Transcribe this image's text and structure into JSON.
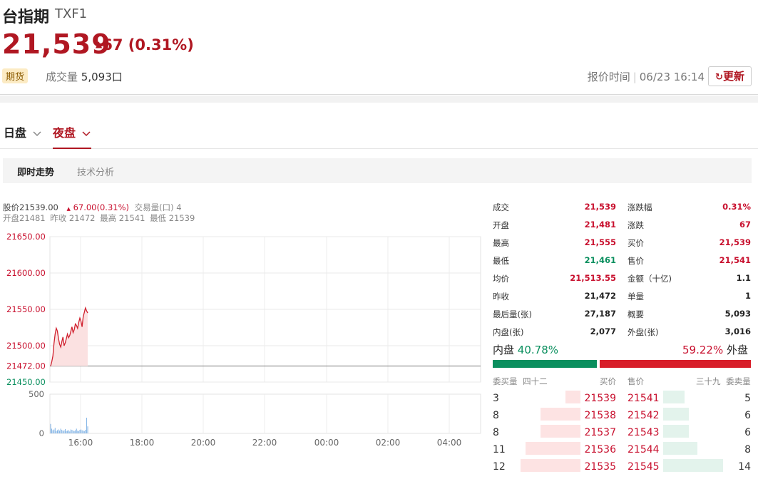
{
  "header": {
    "title": "台指期",
    "symbol": "TXF1",
    "price": "21,539",
    "change_arrow": "▲",
    "change": "67 (0.31%)",
    "badge": "期货",
    "volume_label": "成交量",
    "volume_value": "5,093口",
    "quote_time_label": "报价时间",
    "quote_time": "06/23 16:14",
    "refresh_label": "更新"
  },
  "session_tabs": {
    "day": "日盘",
    "night": "夜盘"
  },
  "sub_tabs": {
    "realtime": "即时走势",
    "technical": "技术分析"
  },
  "chart_info": {
    "line1": {
      "price": "股价21539.00",
      "change_arrow": "▲",
      "change": "67.00(0.31%)",
      "vol": "交易量(口) 4"
    },
    "line2": {
      "open": "开盘21481",
      "prev": "昨收 21472",
      "high": "最高 21541",
      "low": "最低 21539"
    }
  },
  "chart_data": {
    "type": "line",
    "price_axis": [
      "21650.00",
      "21600.00",
      "21550.00",
      "21500.00",
      "21472.00",
      "21450.00"
    ],
    "volume_axis": [
      "500",
      "0"
    ],
    "time_axis": [
      "16:00",
      "18:00",
      "20:00",
      "22:00",
      "00:00",
      "02:00",
      "04:00"
    ],
    "ylim": [
      21450,
      21650
    ],
    "prev_close": 21472,
    "series": [
      {
        "values": [
          21472,
          21478,
          21486,
          21503,
          21516,
          21524,
          21520,
          21510,
          21502,
          21498,
          21506,
          21512,
          21500,
          21504,
          21510,
          21516,
          21511,
          21514,
          21520,
          21526,
          21518,
          21522,
          21530,
          21528,
          21524,
          21532,
          21538,
          21534,
          21526,
          21540,
          21546,
          21552,
          21548,
          21545
        ]
      }
    ],
    "volume_values": [
      120,
      60,
      40,
      50,
      70,
      30,
      40,
      50,
      35,
      60,
      45,
      30,
      40,
      55,
      30,
      35,
      40,
      25,
      50,
      45,
      35,
      30,
      40,
      60,
      35,
      30,
      45,
      50,
      40,
      35,
      30,
      45,
      200,
      90
    ]
  },
  "quote_table": [
    {
      "l1": "成交",
      "v1": "21,539",
      "c1": "red",
      "l2": "涨跌幅",
      "v2": "0.31%",
      "c2": "red"
    },
    {
      "l1": "开盘",
      "v1": "21,481",
      "c1": "red",
      "l2": "涨跌",
      "v2": "67",
      "c2": "red"
    },
    {
      "l1": "最高",
      "v1": "21,555",
      "c1": "red",
      "l2": "买价",
      "v2": "21,539",
      "c2": "red"
    },
    {
      "l1": "最低",
      "v1": "21,461",
      "c1": "green",
      "l2": "售价",
      "v2": "21,541",
      "c2": "red"
    },
    {
      "l1": "均价",
      "v1": "21,513.55",
      "c1": "red",
      "l2": "金额（十亿)",
      "v2": "1.1",
      "c2": ""
    },
    {
      "l1": "昨收",
      "v1": "21,472",
      "c1": "",
      "l2": "单量",
      "v2": "1",
      "c2": ""
    },
    {
      "l1": "最后量(张)",
      "v1": "27,187",
      "c1": "",
      "l2": "概要",
      "v2": "5,093",
      "c2": ""
    },
    {
      "l1": "内盘(张)",
      "v1": "2,077",
      "c1": "",
      "l2": "外盘(张)",
      "v2": "3,016",
      "c2": ""
    }
  ],
  "inner_outer": {
    "inner_label": "内盘",
    "inner_pct": "40.78%",
    "inner_ratio": 0.4078,
    "outer_pct": "59.22%",
    "outer_label": "外盘",
    "outer_ratio": 0.5922
  },
  "order_book": {
    "headers": {
      "bid_qty": "委买量",
      "bid_count": "四十二",
      "bid": "买价",
      "ask": "售价",
      "ask_count": "三十九",
      "ask_qty": "委卖量"
    },
    "rows": [
      {
        "bid_qty": "3",
        "bid": "21539",
        "ask": "21541",
        "ask_qty": "5"
      },
      {
        "bid_qty": "8",
        "bid": "21538",
        "ask": "21542",
        "ask_qty": "6"
      },
      {
        "bid_qty": "8",
        "bid": "21537",
        "ask": "21543",
        "ask_qty": "6"
      },
      {
        "bid_qty": "11",
        "bid": "21536",
        "ask": "21544",
        "ask_qty": "8"
      },
      {
        "bid_qty": "12",
        "bid": "21535",
        "ask": "21545",
        "ask_qty": "14"
      }
    ]
  },
  "colors": {
    "up": "#c8102e",
    "down": "#0a8f5e",
    "accent": "#b01722"
  }
}
